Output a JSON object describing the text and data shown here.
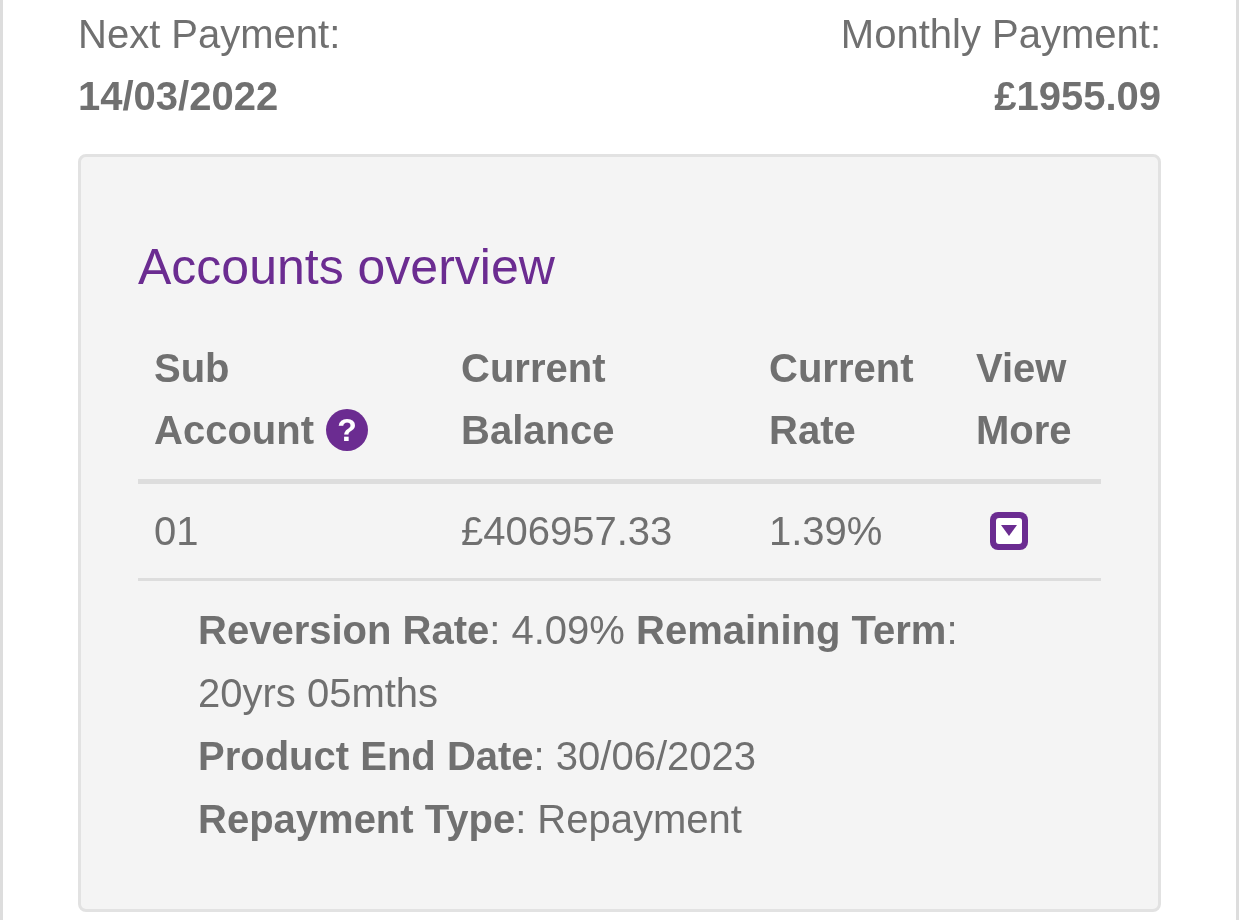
{
  "summary": [
    {
      "label": "Next Payment:",
      "value": "14/03/2022"
    },
    {
      "label": "Monthly Payment:",
      "value": "£1955.09"
    }
  ],
  "accounts": {
    "title": "Accounts overview",
    "columns": [
      {
        "lines": [
          "Sub",
          "Account"
        ],
        "help": "?"
      },
      {
        "lines": [
          "Current",
          "Balance"
        ]
      },
      {
        "lines": [
          "Current",
          "Rate"
        ]
      },
      {
        "lines": [
          "View",
          "More"
        ]
      }
    ],
    "rows": [
      {
        "sub_account": "01",
        "balance": "£406957.33",
        "rate": "1.39%",
        "expanded": true,
        "details": [
          "**Reversion Rate**: 4.09% **Remaining Term**: 20yrs 05mths",
          "**Product End Date**: 30/06/2023",
          "**Repayment Type**: Repayment"
        ]
      }
    ]
  }
}
